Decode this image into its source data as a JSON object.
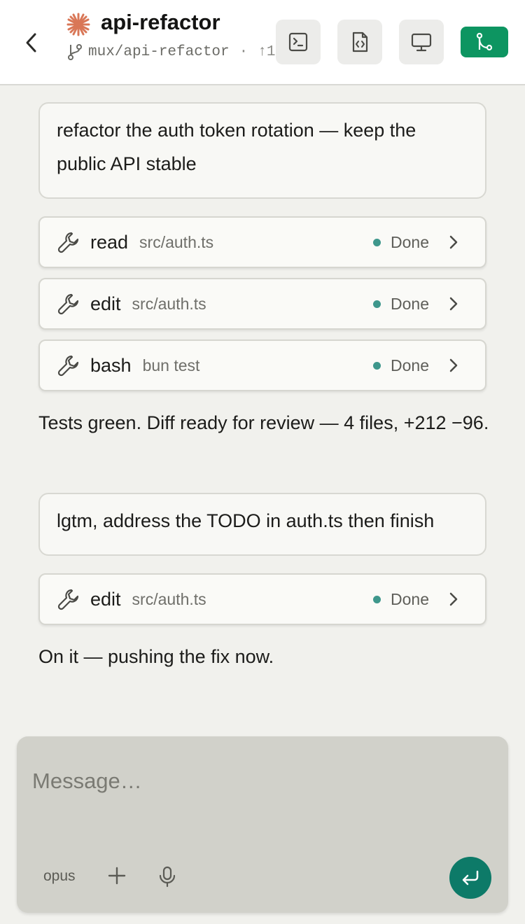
{
  "header": {
    "title": "api-refactor",
    "branch": "mux/api-refactor",
    "separator": "·",
    "ahead": "↑1",
    "brand_color": "#d97757",
    "accent_green": "#0d9561"
  },
  "messages": {
    "user1": "refactor the auth token rotation — keep the public API stable",
    "tool1": {
      "verb": "read",
      "arg": "src/auth.ts",
      "status": "Done"
    },
    "tool2": {
      "verb": "edit",
      "arg": "src/auth.ts",
      "status": "Done"
    },
    "tool3": {
      "verb": "bash",
      "arg": "bun test",
      "status": "Done"
    },
    "assistant1": "Tests green. Diff ready for review — 4 files, +212 −96.",
    "user2": "lgtm, address the TODO in auth.ts then finish",
    "tool4": {
      "verb": "edit",
      "arg": "src/auth.ts",
      "status": "Done"
    },
    "assistant2": "On it — pushing the fix now."
  },
  "composer": {
    "placeholder": "Message…",
    "model": "opus",
    "send_color": "#0d7a68"
  },
  "icons": {
    "back": "chevron-left-icon",
    "brand": "sparkle-icon",
    "branch": "git-branch-icon",
    "terminal": "terminal-icon",
    "file_code": "file-code-icon",
    "monitor": "monitor-icon",
    "merge": "git-merge-icon",
    "tool": "wrench-icon",
    "chevron": "chevron-right-icon",
    "plus": "plus-icon",
    "mic": "mic-icon",
    "send": "enter-icon"
  }
}
